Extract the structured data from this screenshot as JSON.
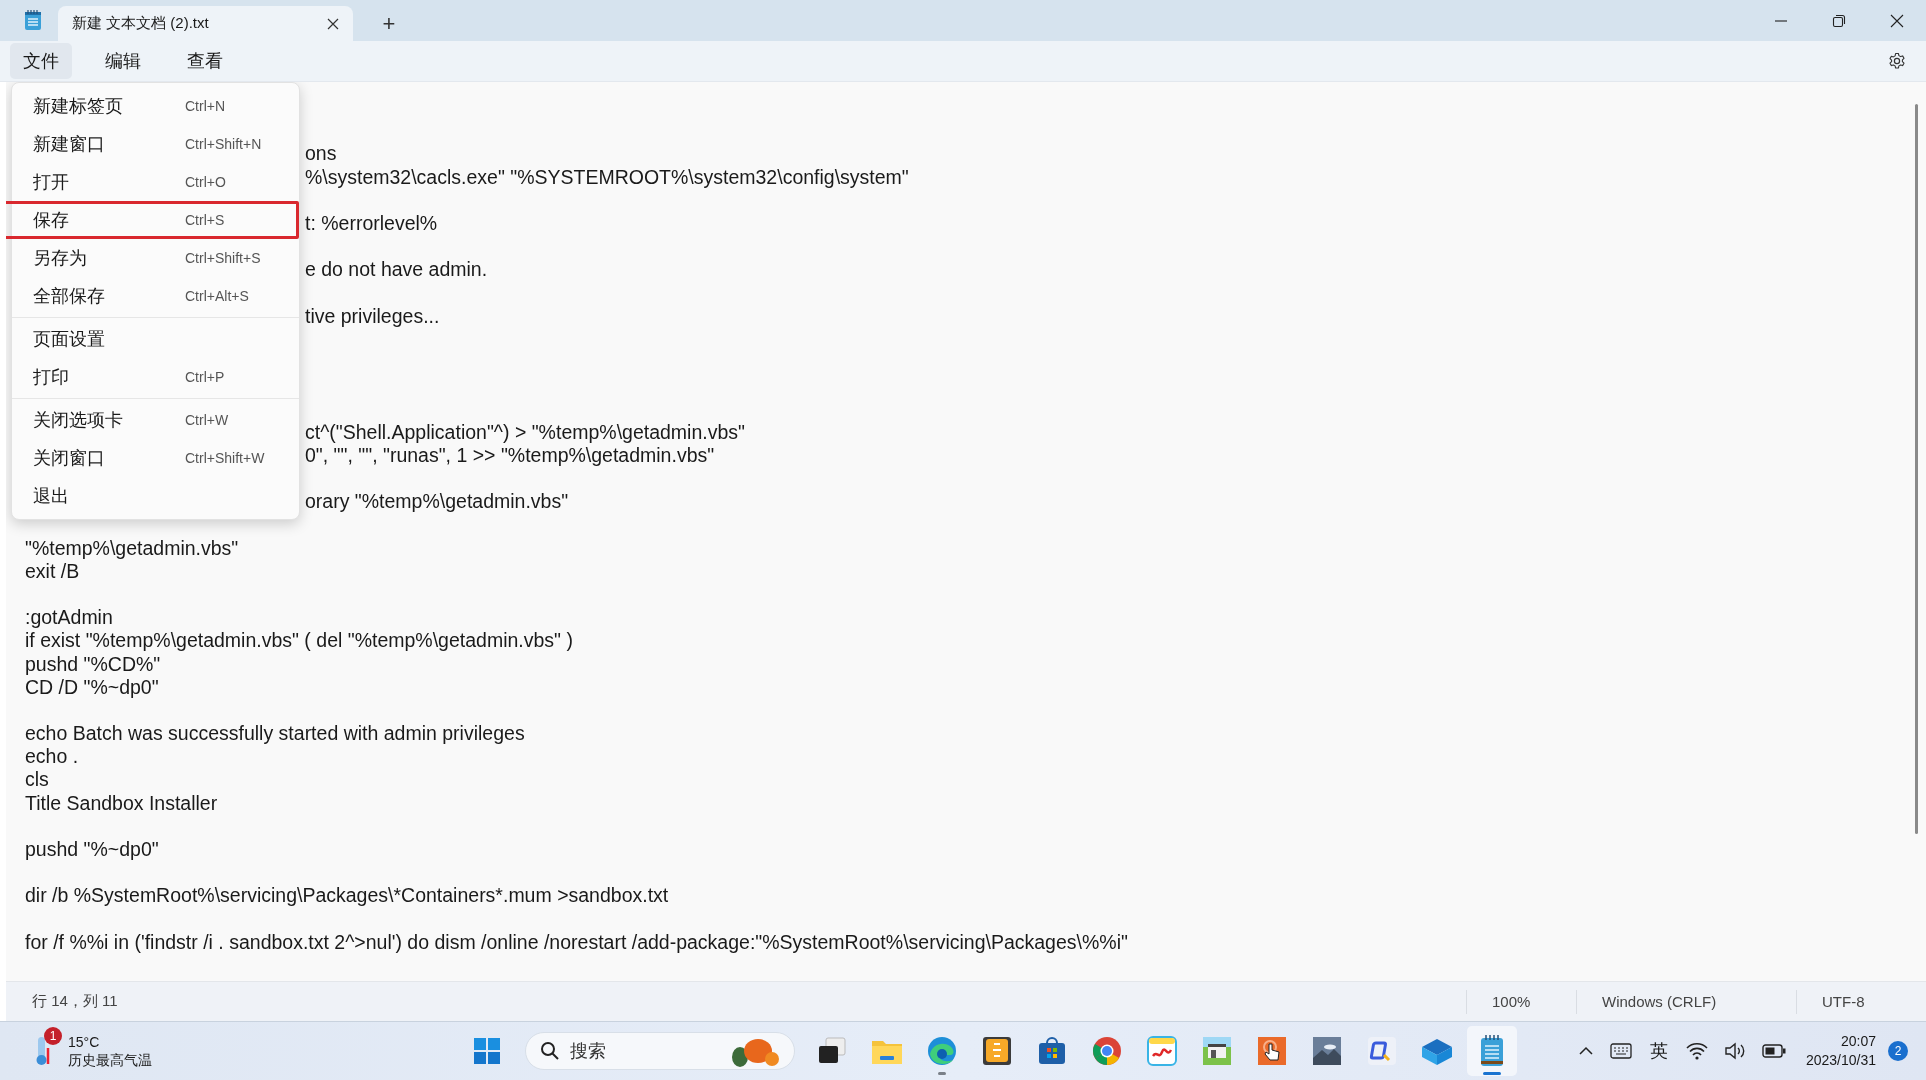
{
  "window": {
    "tab": {
      "title": "新建 文本文档 (2).txt",
      "selected": true
    },
    "new_tab": "+"
  },
  "menubar": [
    {
      "label": "文件",
      "selected": true
    },
    {
      "label": "编辑",
      "selected": false
    },
    {
      "label": "查看",
      "selected": false
    }
  ],
  "file_menu": [
    {
      "label": "新建标签页",
      "shortcut": "Ctrl+N",
      "highlighted": false
    },
    {
      "label": "新建窗口",
      "shortcut": "Ctrl+Shift+N",
      "highlighted": false
    },
    {
      "label": "打开",
      "shortcut": "Ctrl+O",
      "highlighted": false
    },
    {
      "label": "保存",
      "shortcut": "Ctrl+S",
      "highlighted": true
    },
    {
      "label": "另存为",
      "shortcut": "Ctrl+Shift+S",
      "highlighted": false
    },
    {
      "label": "全部保存",
      "shortcut": "Ctrl+Alt+S",
      "highlighted": false,
      "separator_after": true
    },
    {
      "label": "页面设置",
      "highlighted": false
    },
    {
      "label": "打印",
      "shortcut": "Ctrl+P",
      "highlighted": false,
      "separator_after": true
    },
    {
      "label": "关闭选项卡",
      "shortcut": "Ctrl+W",
      "highlighted": false
    },
    {
      "label": "关闭窗口",
      "shortcut": "Ctrl+Shift+W",
      "highlighted": false
    },
    {
      "label": "退出",
      "highlighted": false
    }
  ],
  "editor_lines": [
    {
      "kind": "blank"
    },
    {
      "kind": "blank"
    },
    {
      "kind": "clipped",
      "text": "ons"
    },
    {
      "kind": "clipped",
      "text": "%\\system32\\cacls.exe\" \"%SYSTEMROOT%\\system32\\config\\system\""
    },
    {
      "kind": "blank"
    },
    {
      "kind": "clipped",
      "text": "t: %errorlevel%"
    },
    {
      "kind": "blank"
    },
    {
      "kind": "clipped",
      "text": "e do not have admin."
    },
    {
      "kind": "blank"
    },
    {
      "kind": "clipped",
      "text": "tive privileges..."
    },
    {
      "kind": "blank"
    },
    {
      "kind": "blank"
    },
    {
      "kind": "blank"
    },
    {
      "kind": "blank"
    },
    {
      "kind": "clipped",
      "text": "ct^(\"Shell.Application\"^) > \"%temp%\\getadmin.vbs\""
    },
    {
      "kind": "clipped",
      "text": "0\", \"\", \"\", \"runas\", 1 >> \"%temp%\\getadmin.vbs\""
    },
    {
      "kind": "blank"
    },
    {
      "kind": "clipped",
      "text": "orary \"%temp%\\getadmin.vbs\""
    },
    {
      "kind": "blank"
    },
    {
      "kind": "full",
      "text": "\"%temp%\\getadmin.vbs\""
    },
    {
      "kind": "full",
      "text": "exit /B"
    },
    {
      "kind": "blank"
    },
    {
      "kind": "full",
      "text": ":gotAdmin"
    },
    {
      "kind": "full",
      "text": "if exist \"%temp%\\getadmin.vbs\" ( del \"%temp%\\getadmin.vbs\" )"
    },
    {
      "kind": "full",
      "text": "pushd \"%CD%\""
    },
    {
      "kind": "full",
      "text": "CD /D \"%~dp0\""
    },
    {
      "kind": "blank"
    },
    {
      "kind": "full",
      "text": "echo Batch was successfully started with admin privileges"
    },
    {
      "kind": "full",
      "text": "echo ."
    },
    {
      "kind": "full",
      "text": "cls"
    },
    {
      "kind": "full",
      "text": "Title Sandbox Installer"
    },
    {
      "kind": "blank"
    },
    {
      "kind": "full",
      "text": "pushd \"%~dp0\""
    },
    {
      "kind": "blank"
    },
    {
      "kind": "full",
      "text": "dir /b %SystemRoot%\\servicing\\Packages\\*Containers*.mum >sandbox.txt"
    },
    {
      "kind": "blank"
    },
    {
      "kind": "full",
      "text": "for /f %%i in ('findstr /i . sandbox.txt 2^>nul') do dism /online /norestart /add-package:\"%SystemRoot%\\servicing\\Packages\\%%i\""
    }
  ],
  "status_bar": {
    "position": "行 14，列 11",
    "zoom": "100%",
    "line_ending": "Windows (CRLF)",
    "encoding": "UTF-8"
  },
  "taskbar": {
    "weather": {
      "temperature": "15°C",
      "caption": "历史最高气温",
      "badge": "1"
    },
    "search": {
      "placeholder": "搜索"
    },
    "apps": [
      {
        "kind": "taskview",
        "running": false,
        "active": false
      },
      {
        "kind": "folder",
        "running": false,
        "active": false
      },
      {
        "kind": "edge",
        "running": true,
        "active": false
      },
      {
        "kind": "orangetile",
        "running": false,
        "active": false
      },
      {
        "kind": "store",
        "running": false,
        "active": false
      },
      {
        "kind": "chrome",
        "running": false,
        "active": false
      },
      {
        "kind": "notebook",
        "running": false,
        "active": false
      },
      {
        "kind": "house",
        "running": false,
        "active": false
      },
      {
        "kind": "hand",
        "running": false,
        "active": false
      },
      {
        "kind": "photo",
        "running": false,
        "active": false
      },
      {
        "kind": "qtile",
        "running": false,
        "active": false
      },
      {
        "kind": "box",
        "running": false,
        "active": false
      },
      {
        "kind": "notepad",
        "running": true,
        "active": true
      }
    ],
    "tray": {
      "ime": "英",
      "time": "20:07",
      "date": "2023/10/31",
      "notifications": "2"
    }
  }
}
